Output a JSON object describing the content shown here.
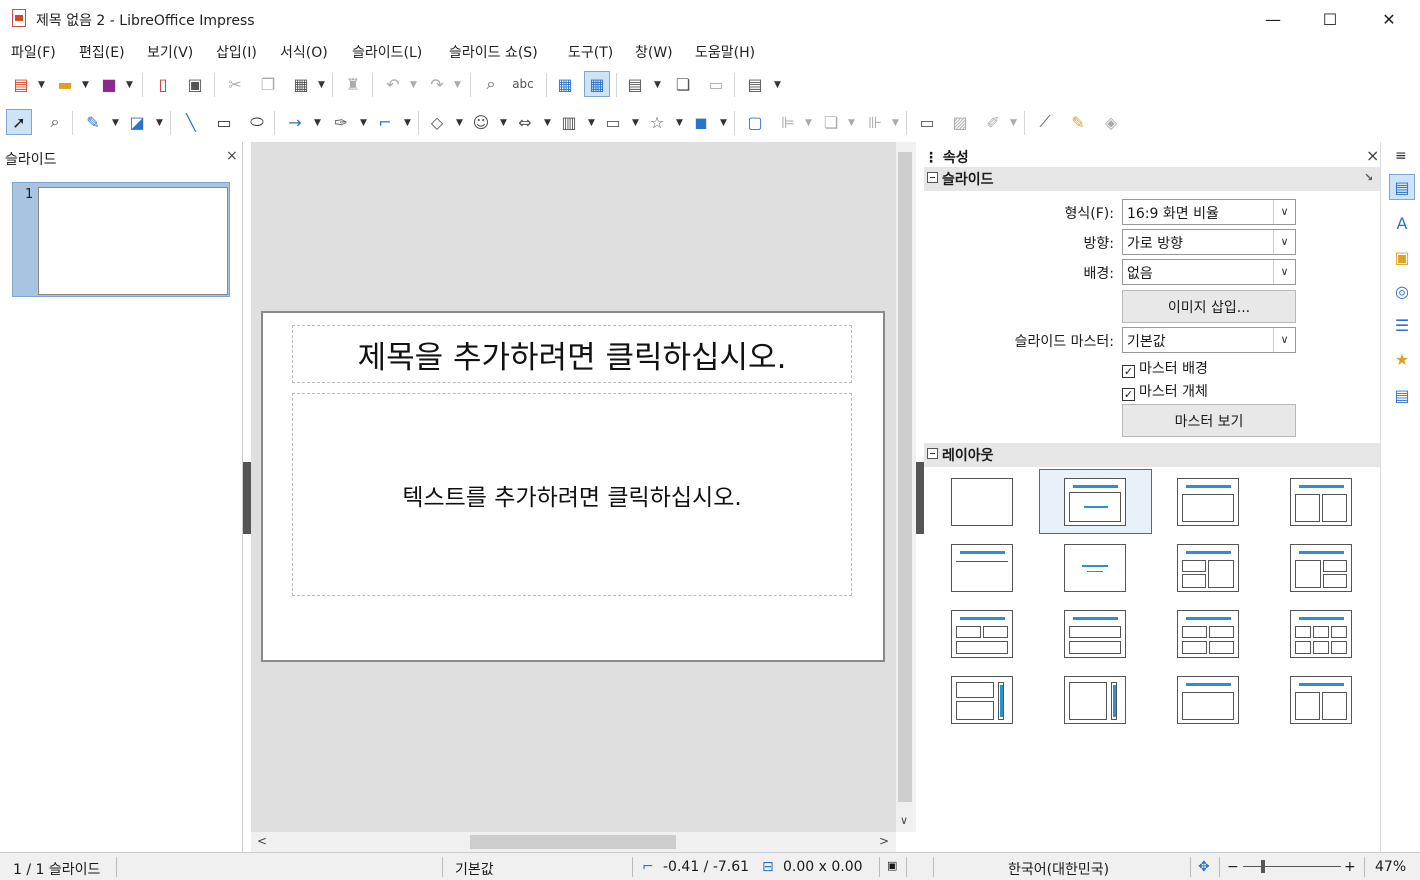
{
  "window": {
    "title": "제목 없음 2 - LibreOffice Impress",
    "minimize": "—",
    "maximize": "☐",
    "close": "✕"
  },
  "menu": [
    "파일(F)",
    "편집(E)",
    "보기(V)",
    "삽입(I)",
    "서식(O)",
    "슬라이드(L)",
    "슬라이드 쇼(S)",
    "도구(T)",
    "창(W)",
    "도움말(H)"
  ],
  "left_panel": {
    "title": "슬라이드",
    "close": "×",
    "slide_number": "1"
  },
  "slide": {
    "title_placeholder": "제목을 추가하려면 클릭하십시오.",
    "body_placeholder": "텍스트를 추가하려면 클릭하십시오."
  },
  "properties": {
    "title": "속성",
    "close": "×",
    "menu": "≡",
    "slide_section": "슬라이드",
    "format_label": "형식(F):",
    "format_value": "16:9 화면 비율",
    "orientation_label": "방향:",
    "orientation_value": "가로 방향",
    "background_label": "배경:",
    "background_value": "없음",
    "insert_image": "이미지 삽입...",
    "master_label": "슬라이드 마스터:",
    "master_value": "기본값",
    "master_background": "마스터 배경",
    "master_objects": "마스터 개체",
    "master_view": "마스터 보기",
    "layout_section": "레이아웃"
  },
  "status": {
    "slide_count": "1 / 1 슬라이드",
    "master": "기본값",
    "position": "-0.41 / -7.61",
    "size": "0.00 x 0.00",
    "language": "한국어(대한민국)",
    "zoom": "47%"
  },
  "colors": {
    "accent": "#2b8fd6",
    "selection": "#a8c4e0"
  }
}
